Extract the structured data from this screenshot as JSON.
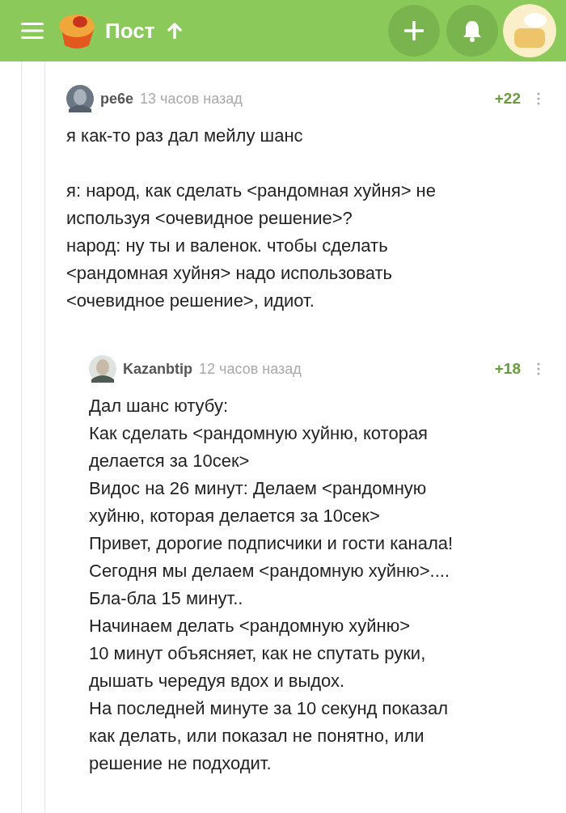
{
  "header": {
    "title": "Пост"
  },
  "comments": [
    {
      "author": "ре6е",
      "time": "13 часов назад",
      "rating": "+22",
      "paragraphs": [
        [
          "я как-то раз дал мейлу шанс"
        ],
        [
          "я: народ, как сделать <рандомная хуйня> не",
          "используя <очевидное решение>?",
          "народ: ну ты и валенок. чтобы сделать",
          "<рандомная хуйня> надо использовать",
          "<очевидное решение>, идиот."
        ]
      ],
      "replies": [
        {
          "author": "Kazanbtip",
          "time": "12 часов назад",
          "rating": "+18",
          "paragraphs": [
            [
              "Дал шанс ютубу:",
              "Как сделать <рандомную хуйню, которая",
              "делается за 10сек>",
              "Видос на 26 минут: Делаем <рандомную",
              "хуйню, которая делается за 10сек>",
              "Привет, дорогие подписчики и гости канала!",
              "Сегодня мы делаем <рандомную хуйню>....",
              "Бла-бла 15 минут..",
              "Начинаем делать <рандомную хуйню>",
              "10 минут объясняет, как не спутать руки,",
              "дышать чередуя вдох и выдох.",
              "На последней минуте за 10 секунд показал",
              "как делать, или показал не понятно, или",
              "решение не подходит."
            ]
          ]
        }
      ]
    }
  ]
}
